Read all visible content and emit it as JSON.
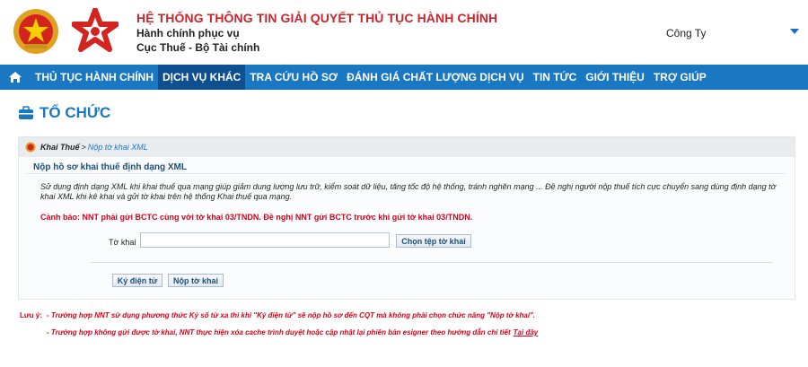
{
  "header": {
    "title": "HỆ THỐNG THÔNG TIN GIẢI QUYẾT THỦ TỤC HÀNH CHÍNH",
    "subtitle1": "Hành chính phục vụ",
    "subtitle2": "Cục Thuế - Bộ Tài chính",
    "user_label": "Công Ty",
    "brand_red": "#c9252c",
    "brand_blue": "#1a78c2"
  },
  "nav": {
    "home_icon": "home-icon",
    "items": [
      {
        "label": "THỦ TỤC HÀNH CHÍNH",
        "active": false
      },
      {
        "label": "DỊCH VỤ KHÁC",
        "active": true
      },
      {
        "label": "TRA CỨU HỒ SƠ",
        "active": false
      },
      {
        "label": "ĐÁNH GIÁ CHẤT LƯỢNG DỊCH VỤ",
        "active": false
      },
      {
        "label": "TIN TỨC",
        "active": false
      },
      {
        "label": "GIỚI THIỆU",
        "active": false
      },
      {
        "label": "TRỢ GIÚP",
        "active": false
      }
    ]
  },
  "page": {
    "title": "TỔ CHỨC",
    "title_icon": "briefcase-icon"
  },
  "breadcrumb": {
    "home": "Khai Thuế",
    "separator": ">",
    "current": "Nộp tờ khai XML"
  },
  "form": {
    "section_title": "Nộp hồ sơ khai thuế định dạng XML",
    "description": "Sử dụng định dạng XML khi khai thuế qua mạng giúp giảm dung lượng lưu trữ, kiểm soát dữ liệu, tăng tốc độ hệ thống, tránh nghẽn mạng ... Đề nghị người nộp thuế tích cực chuyển sang dùng định dạng tờ khai XML khi kê khai và gửi tờ khai trên hệ thống Khai thuế qua mạng.",
    "warning": "Cảnh báo: NNT phải gửi BCTC cùng với tờ khai 03/TNDN. Đề nghị NNT gửi BCTC trước khi gửi tờ khai 03/TNDN.",
    "file_label": "Tờ khai",
    "file_value": "",
    "choose_button": "Chọn tệp tờ khai",
    "sign_button": "Ký điện tử",
    "submit_button": "Nộp tờ khai"
  },
  "notes": {
    "label": "Lưu ý:",
    "note1": "- Trường hợp NNT sử dụng phương thức Ký số từ xa thì khi \"Ký điện tử\" sẽ nộp hồ sơ đến CQT mà không phải chọn chức năng \"Nộp tờ khai\".",
    "note2": "- Trường hợp không gửi được tờ khai, NNT thực hiện xóa cache trình duyệt hoặc cập nhật lại phiên bản esigner theo hướng dẫn chi tiết",
    "link": "Tại đây"
  }
}
